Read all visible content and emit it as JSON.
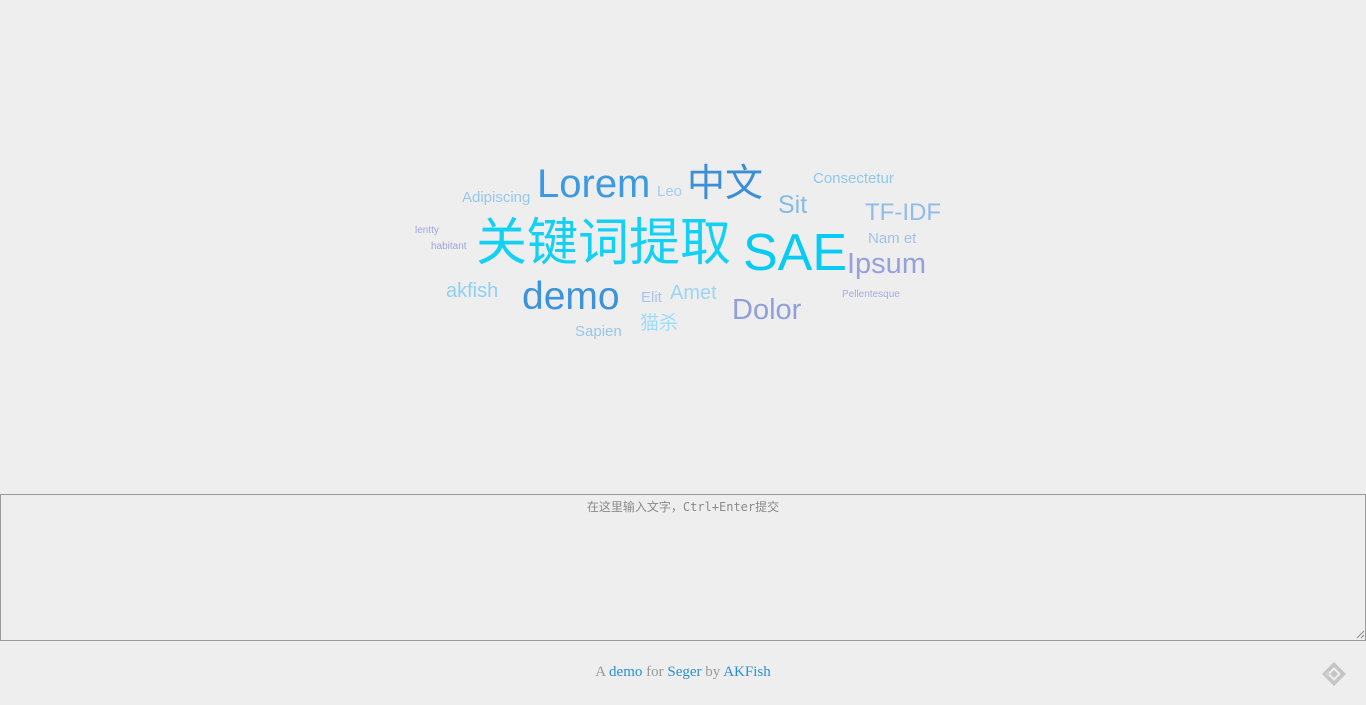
{
  "word_cloud": {
    "words": [
      {
        "text": "关键词提取",
        "color": "#12d1f5"
      },
      {
        "text": "SAE",
        "color": "#08cbf2"
      },
      {
        "text": "Lorem",
        "color": "#3a9ae2"
      },
      {
        "text": "中文",
        "color": "#3a8fd6"
      },
      {
        "text": "demo",
        "color": "#3a93dc"
      },
      {
        "text": "Dolor",
        "color": "#8fa0da"
      },
      {
        "text": "Ipsum",
        "color": "#96a0dc"
      },
      {
        "text": "TF-IDF",
        "color": "#8fbde8"
      },
      {
        "text": "Sit",
        "color": "#86bbe8"
      },
      {
        "text": "Consectetur",
        "color": "#8ec8ec"
      },
      {
        "text": "Adipiscing",
        "color": "#95c8ec"
      },
      {
        "text": "Leo",
        "color": "#a6cdee"
      },
      {
        "text": "Nam et",
        "color": "#a3c1ec"
      },
      {
        "text": "akfish",
        "color": "#8ed1f3"
      },
      {
        "text": "Amet",
        "color": "#9cd5f5"
      },
      {
        "text": "Elit",
        "color": "#a5c5ec"
      },
      {
        "text": "猫杀",
        "color": "#9fdcf5"
      },
      {
        "text": "Sapien",
        "color": "#98c6ea"
      },
      {
        "text": "Pellentesque",
        "color": "#a3aee2"
      },
      {
        "text": "lentty",
        "color": "#9ea8e0"
      },
      {
        "text": "habitant",
        "color": "#9ea6de"
      }
    ]
  },
  "input": {
    "placeholder": "在这里输入文字，Ctrl+Enter提交",
    "value": ""
  },
  "footer": {
    "prefix": "A",
    "demo_link": "demo",
    "for_text": "for",
    "seger_link": "Seger",
    "by_text": "by",
    "author_link": "AKFish",
    "link_color": "#2a8fd6"
  },
  "corner_icon": "ribbon-logo-icon"
}
